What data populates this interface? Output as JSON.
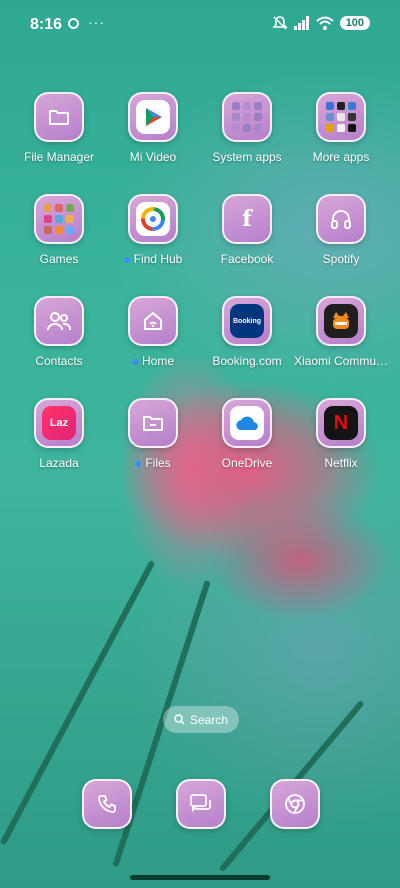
{
  "status_bar": {
    "time": "8:16",
    "more": "···",
    "battery": "100"
  },
  "apps": [
    {
      "label": "File Manager",
      "icon": "folder-icon",
      "dot": false
    },
    {
      "label": "Mi Video",
      "icon": "play-icon",
      "dot": false
    },
    {
      "label": "System apps",
      "icon": "folder-grid-icon",
      "dot": false
    },
    {
      "label": "More apps",
      "icon": "folder-grid-icon",
      "dot": false
    },
    {
      "label": "Games",
      "icon": "folder-grid-icon",
      "dot": false
    },
    {
      "label": "Find Hub",
      "icon": "find-hub-icon",
      "dot": true
    },
    {
      "label": "Facebook",
      "icon": "facebook-icon",
      "dot": false
    },
    {
      "label": "Spotify",
      "icon": "headphones-icon",
      "dot": false
    },
    {
      "label": "Contacts",
      "icon": "contacts-icon",
      "dot": false
    },
    {
      "label": "Home",
      "icon": "home-icon",
      "dot": true
    },
    {
      "label": "Booking.com",
      "icon": "booking-icon",
      "dot": false
    },
    {
      "label": "Xiaomi Commu…",
      "icon": "xiaomi-community-icon",
      "dot": false
    },
    {
      "label": "Lazada",
      "icon": "lazada-icon",
      "dot": false
    },
    {
      "label": "Files",
      "icon": "files-icon",
      "dot": true
    },
    {
      "label": "OneDrive",
      "icon": "onedrive-icon",
      "dot": false
    },
    {
      "label": "Netflix",
      "icon": "netflix-icon",
      "dot": false
    }
  ],
  "icon_text": {
    "booking": "Booking",
    "lazada": "Laz",
    "netflix": "N",
    "facebook": "f"
  },
  "search": {
    "label": "Search"
  },
  "dock": [
    {
      "name": "phone",
      "icon": "phone-icon"
    },
    {
      "name": "messages",
      "icon": "messages-icon"
    },
    {
      "name": "chrome",
      "icon": "chrome-icon"
    }
  ],
  "colors": {
    "accent": "#3c8cff",
    "icon_bg": "#c08ccf",
    "wallpaper": "#38b39a",
    "flower": "#e85a82"
  }
}
